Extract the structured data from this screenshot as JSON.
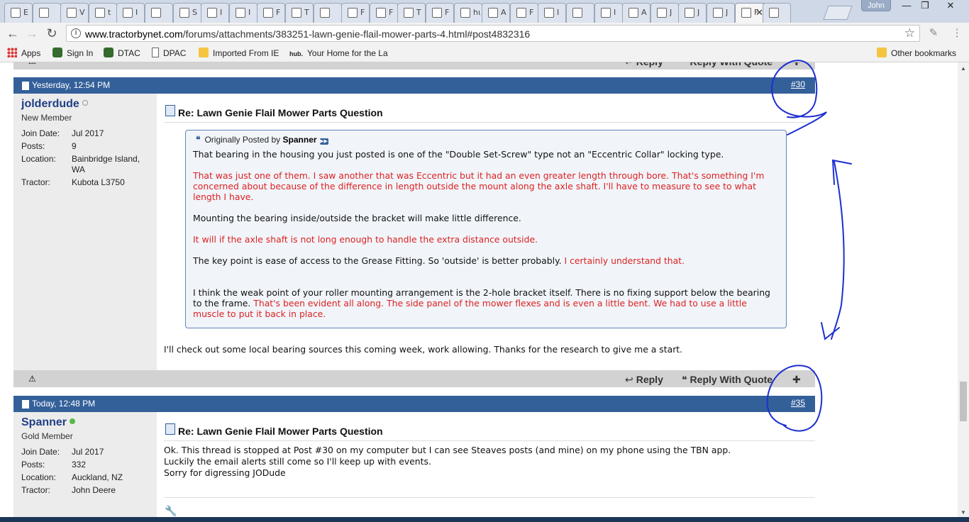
{
  "browser": {
    "tabs": [
      {
        "label": "E"
      },
      {
        "label": ""
      },
      {
        "label": "V"
      },
      {
        "label": "t"
      },
      {
        "label": "I"
      },
      {
        "label": ""
      },
      {
        "label": "S"
      },
      {
        "label": "I"
      },
      {
        "label": "I"
      },
      {
        "label": "F"
      },
      {
        "label": "T"
      },
      {
        "label": ""
      },
      {
        "label": "F"
      },
      {
        "label": "F"
      },
      {
        "label": "T"
      },
      {
        "label": "F"
      },
      {
        "label": "hub. S"
      },
      {
        "label": "A"
      },
      {
        "label": "F"
      },
      {
        "label": "I"
      },
      {
        "label": ""
      },
      {
        "label": "I"
      },
      {
        "label": "A"
      },
      {
        "label": "J"
      },
      {
        "label": "J"
      },
      {
        "label": "J"
      },
      {
        "label": "F"
      },
      {
        "label": ""
      }
    ],
    "profile_name": "John",
    "url_host": "www.tractorbynet.com",
    "url_path": "/forums/attachments/383251-lawn-genie-flail-mower-parts-4.html#post4832316",
    "window": {
      "min": "—",
      "max": "❐",
      "close": "✕"
    },
    "nav": {
      "back": "←",
      "forward": "→",
      "reload": "↻"
    },
    "bookmarks": [
      {
        "label": "Apps",
        "icon": "apps-grid-icon"
      },
      {
        "label": "Sign In",
        "icon": "deere-icon"
      },
      {
        "label": "DTAC",
        "icon": "deere-icon"
      },
      {
        "label": "DPAC",
        "icon": "page-icon"
      },
      {
        "label": "Imported From IE",
        "icon": "folder-icon"
      },
      {
        "label": "Your Home for the La",
        "icon": "hub-icon",
        "prefix": "hub."
      }
    ],
    "other_bookmarks": "Other bookmarks"
  },
  "posts": [
    {
      "date": "Yesterday, 12:54 PM",
      "number": "#30",
      "user": {
        "name": "jolderdude",
        "rank": "New Member",
        "status_color": "#b0b0b0"
      },
      "stats": [
        {
          "k": "Join Date:",
          "v": "Jul 2017"
        },
        {
          "k": "Posts:",
          "v": "9"
        },
        {
          "k": "Location:",
          "v": "Bainbridge Island, WA"
        },
        {
          "k": "Tractor:",
          "v": "Kubota L3750"
        }
      ],
      "title": "Re: Lawn Genie Flail Mower Parts Question",
      "quote": {
        "originally_posted_by": "Originally Posted by",
        "author": "Spanner",
        "p1": "That bearing in the housing you just posted is one of the \"Double Set-Screw\" type not an \"Eccentric Collar\" locking type.",
        "p2_red": "That was just one of them. I saw another that was Eccentric but it had an even greater length through bore. That's something I'm concerned about because of the difference in length outside the mount along the axle shaft. I'll have to measure to see to what length I have.",
        "p3": "Mounting the bearing inside/outside the bracket will make little difference.",
        "p4_red": "It will if the axle shaft is not long enough to handle the extra distance outside.",
        "p5_black": "The key point is ease of access to the Grease Fitting. So 'outside' is better probably. ",
        "p5_red": "I certainly understand that.",
        "p6_black": "I think the weak point of your roller mounting arrangement is the 2-hole bracket itself. There is no fixing support below the bearing to the frame. ",
        "p6_red": "That's been evident all along. The side panel of the mower flexes and is even a little bent. We had to use a little muscle to put it back in place."
      },
      "text": "I'll check out some local bearing sources this coming week, work allowing. Thanks for the research to give me a start."
    },
    {
      "date": "Today, 12:48 PM",
      "number": "#35",
      "user": {
        "name": "Spanner",
        "rank": "Gold Member",
        "status_color": "#58b947"
      },
      "stats": [
        {
          "k": "Join Date:",
          "v": "Jul 2017"
        },
        {
          "k": "Posts:",
          "v": "332"
        },
        {
          "k": "Location:",
          "v": "Auckland, NZ"
        },
        {
          "k": "Tractor:",
          "v": "John Deere"
        }
      ],
      "title": "Re: Lawn Genie Flail Mower Parts Question",
      "text_lines": [
        "Ok. This thread is stopped at Post #30 on my computer but I can see Steaves posts (and mine) on my phone using the TBN app.",
        "Luckily the email alerts still come so I'll keep up with events.",
        "Sorry for digressing JODude"
      ]
    }
  ],
  "actions": {
    "reply": "Reply",
    "reply_with_quote": "Reply With Quote"
  },
  "colors": {
    "header_blue": "#34609a",
    "username_blue": "#1f3f86",
    "quote_red": "#dd2222",
    "annotation_ink": "#1d2fd0"
  }
}
